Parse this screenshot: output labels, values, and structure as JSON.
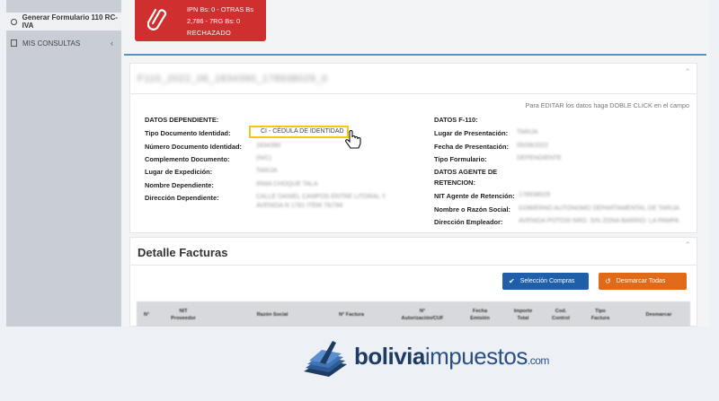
{
  "sidebar": {
    "items": [
      {
        "label": "Generar Formulario 110 RC-IVA"
      },
      {
        "label": "MIS CONSULTAS"
      }
    ]
  },
  "alert": {
    "line1": "IPN Bs: 0 - OTRAS Bs",
    "line2": "2,786 - 7RG Bs: 0",
    "line3": "RECHAZADO"
  },
  "card1": {
    "code": "F110_2022_06_1834390_178938029_0",
    "hint": "Para EDITAR los datos haga DOBLE CLICK en el campo",
    "left_heading": "DATOS DEPENDIENTE:",
    "left": [
      {
        "label": "Tipo Documento Identidad:",
        "value": "CI - CÉDULA DE IDENTIDAD"
      },
      {
        "label": "Número Documento Identidad:",
        "value": "1834390"
      },
      {
        "label": "Complemento Documento:",
        "value": "(N/C)"
      },
      {
        "label": "Lugar de Expedición:",
        "value": "TARIJA"
      },
      {
        "label": "Nombre Dependiente:",
        "value": "IRMA CHOQUE TALA"
      },
      {
        "label": "Dirección Dependiente:",
        "value": "CALLE DANIEL CAMPOS ENTRE LITORAL Y",
        "value2": "AVENIDA N 1781 ITEM 76/784"
      }
    ],
    "right_heading": "DATOS F-110:",
    "right": [
      {
        "label": "Lugar de Presentación:",
        "value": "TARIJA"
      },
      {
        "label": "Fecha de Presentación:",
        "value": "05/08/2022"
      },
      {
        "label": "Tipo Formulario:",
        "value": "DEPENDIENTE"
      }
    ],
    "agent_heading1": "DATOS AGENTE DE",
    "agent_heading2": "RETENCION:",
    "agent": [
      {
        "label": "NIT Agente de Retención:",
        "value": "178938029"
      },
      {
        "label": "Nombre o Razón Social:",
        "value": "GOBIERNO AUTONOMO DEPARTAMENTAL DE TARIJA"
      },
      {
        "label": "Dirección Empleador:",
        "value": "AVENIDA POTOSI NRO. S/N ZONA BARRIO: LA PAMPA"
      }
    ]
  },
  "card2": {
    "title": "Detalle Facturas",
    "btn_select": "Selección Compras",
    "btn_unmark": "Desmarcar Todas",
    "columns": [
      {
        "l1": "N°",
        "l2": ""
      },
      {
        "l1": "NIT",
        "l2": "Proveedor"
      },
      {
        "l1": "Razón Social",
        "l2": ""
      },
      {
        "l1": "N° Factura",
        "l2": ""
      },
      {
        "l1": "N°",
        "l2": "Autorización/CUF"
      },
      {
        "l1": "Fecha",
        "l2": "Emisión"
      },
      {
        "l1": "Importe",
        "l2": "Total"
      },
      {
        "l1": "Cod.",
        "l2": "Control"
      },
      {
        "l1": "Tipo",
        "l2": "Factura"
      },
      {
        "l1": "Desmarcar",
        "l2": ""
      }
    ]
  },
  "brand": {
    "bold": "bolivia",
    "light": "impuestos",
    "suffix": ".com"
  },
  "colors": {
    "alert": "#d02f2f",
    "primary": "#1f5ea8",
    "warning": "#e06a17",
    "highlight": "#f2c811",
    "brand": "#1e3b63"
  }
}
